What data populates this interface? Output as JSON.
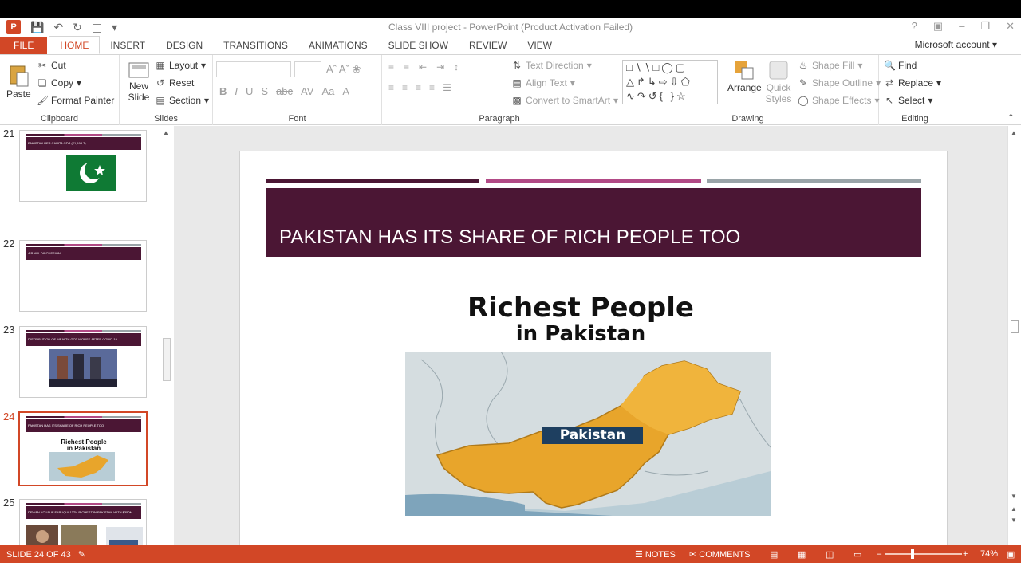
{
  "window": {
    "title": "Class VIII project - PowerPoint (Product Activation Failed)",
    "account": "Microsoft account"
  },
  "tabs": [
    "FILE",
    "HOME",
    "INSERT",
    "DESIGN",
    "TRANSITIONS",
    "ANIMATIONS",
    "SLIDE SHOW",
    "REVIEW",
    "VIEW"
  ],
  "ribbon": {
    "clipboard": {
      "paste": "Paste",
      "cut": "Cut",
      "copy": "Copy",
      "format_painter": "Format Painter",
      "label": "Clipboard"
    },
    "slides": {
      "new_slide": "New Slide",
      "layout": "Layout",
      "reset": "Reset",
      "section": "Section",
      "label": "Slides"
    },
    "font": {
      "label": "Font"
    },
    "paragraph": {
      "text_direction": "Text Direction",
      "align_text": "Align Text",
      "convert": "Convert to SmartArt",
      "label": "Paragraph"
    },
    "drawing": {
      "arrange": "Arrange",
      "quick_styles": "Quick Styles",
      "shape_fill": "Shape Fill",
      "shape_outline": "Shape Outline",
      "shape_effects": "Shape Effects",
      "label": "Drawing"
    },
    "editing": {
      "find": "Find",
      "replace": "Replace",
      "select": "Select",
      "label": "Editing"
    }
  },
  "thumbnails": [
    {
      "num": "21",
      "title": "PAKISTAN PER CAPITA GDP ($1,193.7)"
    },
    {
      "num": "22",
      "title": "A RAWL DISCUSSION"
    },
    {
      "num": "23",
      "title": "DISTRIBUTION OF WEALTH GOT WORSE AFTER COVID-19"
    },
    {
      "num": "24",
      "title": "PAKISTAN HAS ITS SHARE OF RICH PEOPLE TOO",
      "thumb_l1": "Richest People",
      "thumb_l2": "in Pakistan"
    },
    {
      "num": "25",
      "title": "DEWAN YOUSUF FARUQUI 13TH RICHEST IN PAKISTAN WITH $350M"
    }
  ],
  "slide": {
    "title": "PAKISTAN HAS ITS SHARE OF RICH PEOPLE TOO",
    "image_line1": "Richest People",
    "image_line2": "in Pakistan",
    "map_label": "Pakistan"
  },
  "status": {
    "slide_counter": "SLIDE 24 OF 43",
    "notes": "NOTES",
    "comments": "COMMENTS",
    "zoom": "74%"
  },
  "colors": {
    "accent": "#d24726",
    "slide_header": "#4b1634",
    "stripe2": "#b24a86",
    "stripe3": "#9aa4a8"
  }
}
